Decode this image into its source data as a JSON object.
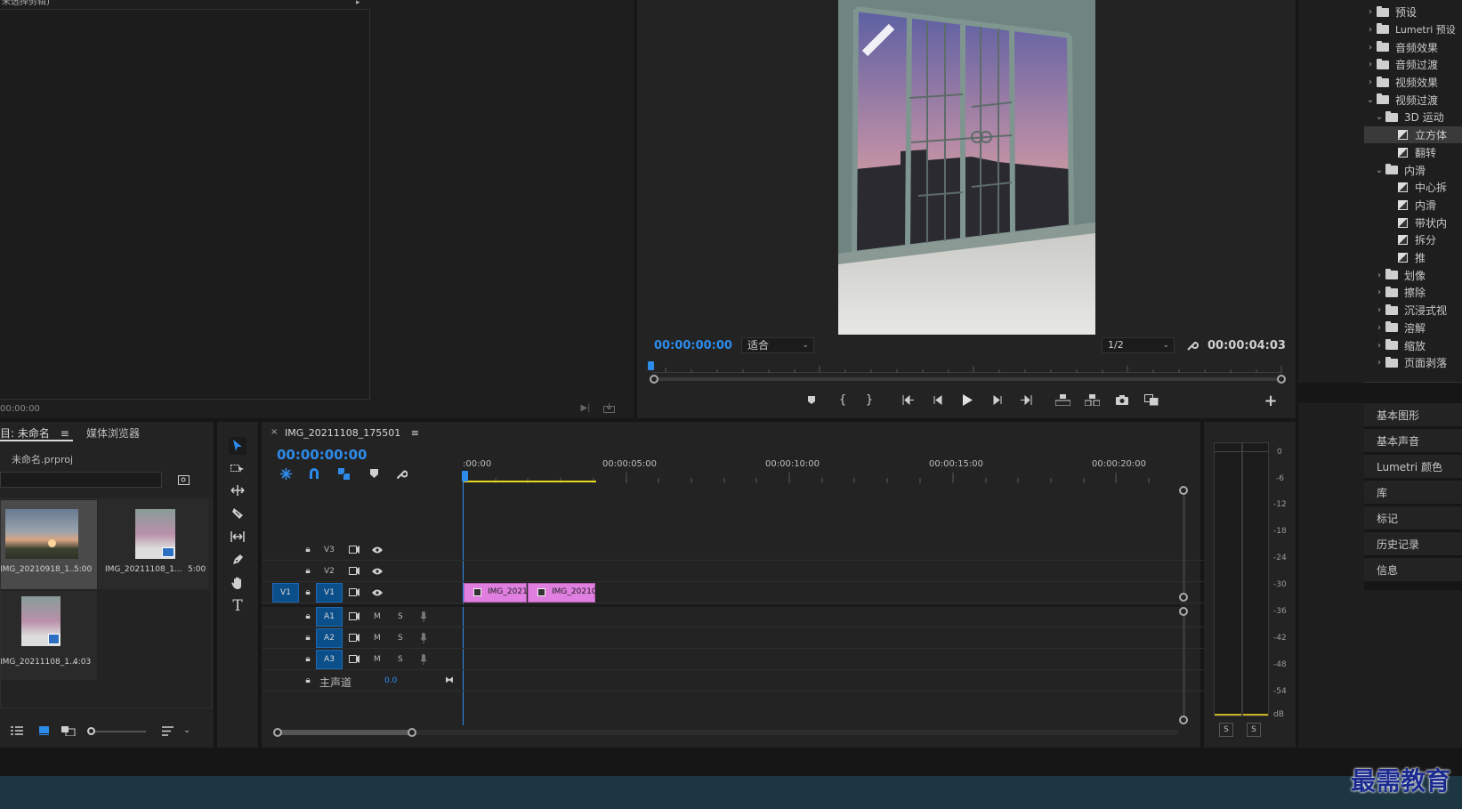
{
  "source_monitor": {
    "header": "未选择剪辑)",
    "timecode": "00:00:00"
  },
  "program_monitor": {
    "timecode": "00:00:00:00",
    "fit": "适合",
    "resolution": "1/2",
    "duration": "00:00:04:03"
  },
  "project": {
    "tab_project": "项目: 未命名",
    "tab_media_browser": "媒体浏览器",
    "file": "未命名.prproj",
    "items": [
      {
        "name": "IMG_20210918_1...",
        "duration": "5:00"
      },
      {
        "name": "IMG_20211108_1...",
        "duration": "5:00"
      },
      {
        "name": "IMG_20211108_1...",
        "duration": "4:03"
      }
    ]
  },
  "timeline": {
    "tab": "IMG_20211108_175501",
    "timecode": "00:00:00:00",
    "ruler": [
      ":00:00",
      "00:00:05:00",
      "00:00:10:00",
      "00:00:15:00",
      "00:00:20:00"
    ],
    "tracks": {
      "V3": "V3",
      "V2": "V2",
      "V1_src": "V1",
      "V1": "V1",
      "A1": "A1",
      "A2": "A2",
      "A3": "A3",
      "M": "M",
      "S": "S",
      "master": "主声道",
      "master_value": "0.0"
    },
    "clips": [
      "IMG_2021",
      "IMG_20210"
    ]
  },
  "effects": {
    "items": [
      {
        "chev": ">",
        "type": "folder",
        "label": "预设",
        "level": 0
      },
      {
        "chev": ">",
        "type": "folder",
        "label": "Lumetri 预设",
        "level": 0
      },
      {
        "chev": ">",
        "type": "folder",
        "label": "音频效果",
        "level": 0
      },
      {
        "chev": ">",
        "type": "folder",
        "label": "音频过渡",
        "level": 0
      },
      {
        "chev": ">",
        "type": "folder",
        "label": "视频效果",
        "level": 0
      },
      {
        "chev": "v",
        "type": "folder",
        "label": "视频过渡",
        "level": 0
      },
      {
        "chev": "v",
        "type": "folder",
        "label": "3D 运动",
        "level": 1
      },
      {
        "chev": "",
        "type": "transition",
        "label": "立方体",
        "level": 2,
        "selected": true
      },
      {
        "chev": "",
        "type": "transition",
        "label": "翻转",
        "level": 2
      },
      {
        "chev": "v",
        "type": "folder",
        "label": "内滑",
        "level": 1
      },
      {
        "chev": "",
        "type": "transition",
        "label": "中心拆",
        "level": 2
      },
      {
        "chev": "",
        "type": "transition",
        "label": "内滑",
        "level": 2
      },
      {
        "chev": "",
        "type": "transition",
        "label": "带状内",
        "level": 2
      },
      {
        "chev": "",
        "type": "transition",
        "label": "拆分",
        "level": 2
      },
      {
        "chev": "",
        "type": "transition",
        "label": "推",
        "level": 2
      },
      {
        "chev": ">",
        "type": "folder",
        "label": "划像",
        "level": 1
      },
      {
        "chev": ">",
        "type": "folder",
        "label": "擦除",
        "level": 1
      },
      {
        "chev": ">",
        "type": "folder",
        "label": "沉浸式视",
        "level": 1
      },
      {
        "chev": ">",
        "type": "folder",
        "label": "溶解",
        "level": 1
      },
      {
        "chev": ">",
        "type": "folder",
        "label": "缩放",
        "level": 1
      },
      {
        "chev": ">",
        "type": "folder",
        "label": "页面剥落",
        "level": 1
      }
    ]
  },
  "side_panels": [
    "基本图形",
    "基本声音",
    "Lumetri 颜色",
    "库",
    "标记",
    "历史记录",
    "信息"
  ],
  "audio_meter": {
    "scale": [
      "0",
      "-6",
      "-12",
      "-18",
      "-24",
      "-30",
      "-36",
      "-42",
      "-48",
      "-54",
      "dB"
    ],
    "solo": "S"
  },
  "watermark": "最需教育",
  "colors": {
    "accent": "#2d8ceb",
    "clip": "#e07fe0",
    "track_target": "#0b4f8a",
    "playhead": "#2d8ceb"
  }
}
